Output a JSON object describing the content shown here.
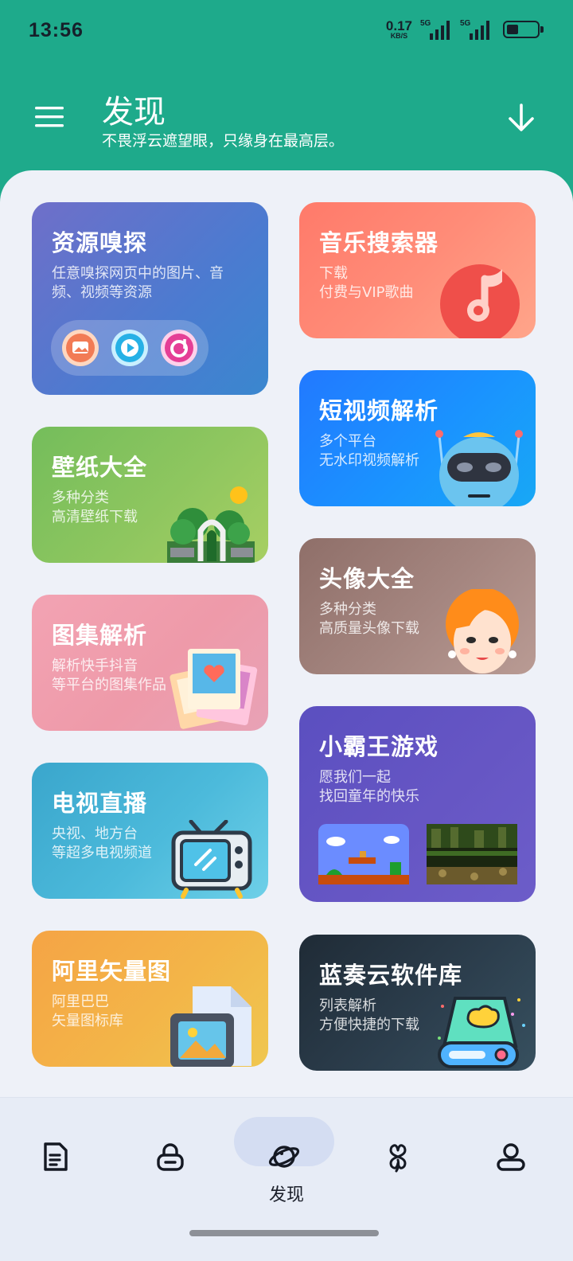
{
  "status_bar": {
    "time": "13:56",
    "net_speed": "0.17",
    "net_unit": "KB/S",
    "sim1": "5G",
    "sim2": "5G"
  },
  "header": {
    "title": "发现",
    "subtitle": "不畏浮云遮望眼，只缘身在最高层。",
    "menu_icon": "hamburger-menu-icon",
    "download_icon": "arrow-down-icon"
  },
  "cards": {
    "sniff": {
      "title": "资源嗅探",
      "desc": "任意嗅探网页中的图片、音频、视频等资源"
    },
    "music": {
      "title": "音乐搜索器",
      "desc_line1": "下载",
      "desc_line2": "付费与VIP歌曲"
    },
    "short_video": {
      "title": "短视频解析",
      "desc_line1": "多个平台",
      "desc_line2": "无水印视频解析"
    },
    "wallpaper": {
      "title": "壁纸大全",
      "desc_line1": "多种分类",
      "desc_line2": "高清壁纸下载"
    },
    "avatar": {
      "title": "头像大全",
      "desc_line1": "多种分类",
      "desc_line2": "高质量头像下载"
    },
    "gallery": {
      "title": "图集解析",
      "desc_line1": "解析快手抖音",
      "desc_line2": "等平台的图集作品"
    },
    "game": {
      "title": "小霸王游戏",
      "desc_line1": "愿我们一起",
      "desc_line2": "找回童年的快乐"
    },
    "tv": {
      "title": "电视直播",
      "desc_line1": "央视、地方台",
      "desc_line2": "等超多电视频道"
    },
    "vector": {
      "title": "阿里矢量图",
      "desc_line1": "阿里巴巴",
      "desc_line2": "矢量图标库"
    },
    "lanzou": {
      "title": "蓝奏云软件库",
      "desc_line1": "列表解析",
      "desc_line2": "方便快捷的下载"
    }
  },
  "bottom_nav": {
    "active_label": "发现",
    "items": [
      "document-icon",
      "lock-icon",
      "planet-icon",
      "clover-icon",
      "user-icon"
    ]
  },
  "colors": {
    "header": "#1eaa8b",
    "background": "#eef1f8"
  }
}
